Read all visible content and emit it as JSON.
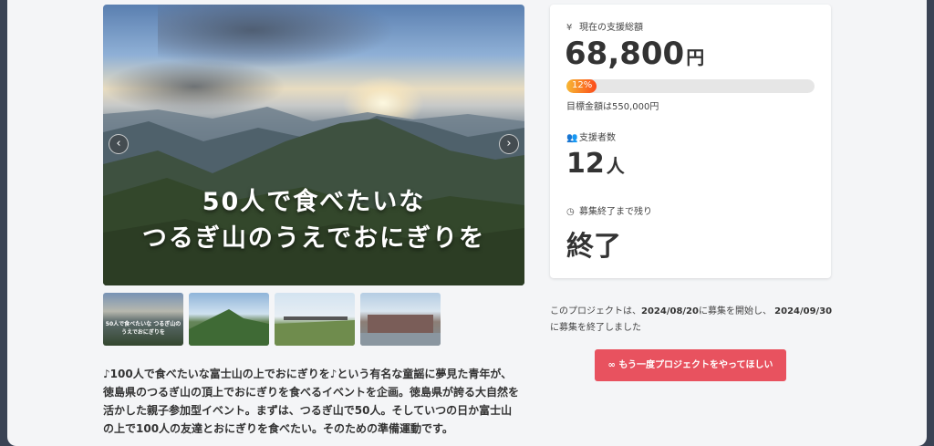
{
  "hero": {
    "title_line1": "50人で食べたいな",
    "title_line2": "つるぎ山のうえでおにぎりを",
    "prev_icon": "chevron-left-icon",
    "next_icon": "chevron-right-icon"
  },
  "thumbnails": [
    {
      "caption": "50人で食べたいな つるぎ山のうえでおにぎりを"
    },
    {
      "caption": ""
    },
    {
      "caption": ""
    },
    {
      "caption": ""
    }
  ],
  "description": "♪100人で食べたいな富士山の上でおにぎりを♪という有名な童謡に夢見た青年が、徳島県のつるぎ山の頂上でおにぎりを食べるイベントを企画。徳島県が誇る大自然を活かした親子参加型イベント。まずは、つるぎ山で50人。そしていつの日か富士山の上で100人の友達とおにぎりを食べたい。そのための準備運動です。",
  "stats": {
    "total_label": "現在の支援総額",
    "total_icon": "yen-icon",
    "total_amount": "68,800",
    "total_unit": "円",
    "progress_percent": 12,
    "progress_label": "12%",
    "goal_text": "目標金額は550,000円",
    "supporters_label": "支援者数",
    "supporters_icon": "users-icon",
    "supporters_count": "12",
    "supporters_unit": "人",
    "remaining_label": "募集終了まで残り",
    "remaining_icon": "clock-icon",
    "remaining_value": "終了"
  },
  "note": {
    "prefix": "このプロジェクトは、",
    "start_date": "2024/08/20",
    "middle": "に募集を開始し、",
    "end_date": "2024/09/30",
    "suffix": "に募集を終了しました"
  },
  "cta": {
    "icon": "infinity-icon",
    "label": "もう一度プロジェクトをやってほしい"
  }
}
